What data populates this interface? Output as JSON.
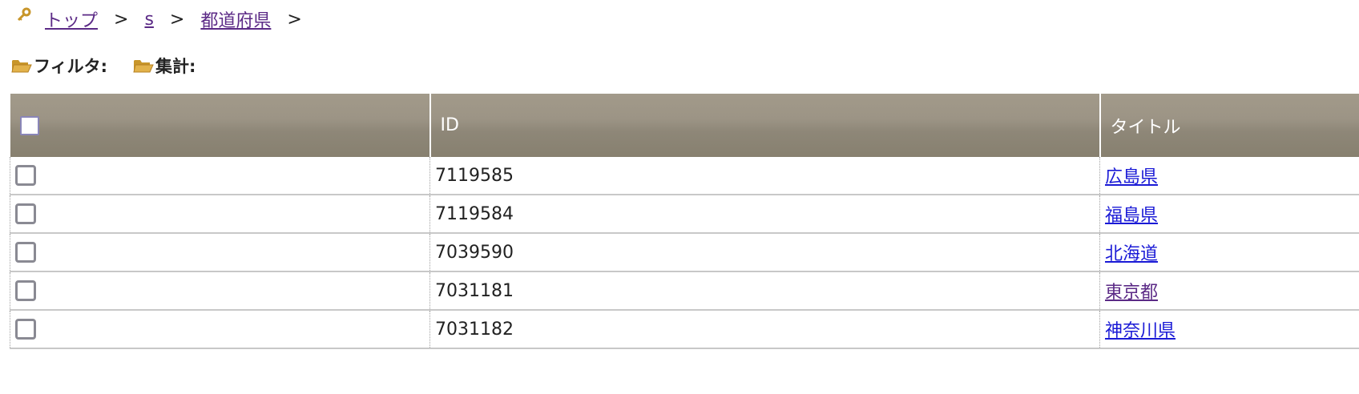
{
  "breadcrumb": {
    "icon": "link-icon",
    "items": [
      "トップ",
      "s",
      "都道府県"
    ],
    "separator": ">"
  },
  "toolbar": {
    "filter_label": "フィルタ:",
    "aggregate_label": "集計:",
    "icon": "folder-open-icon",
    "icon_color": "#d4a338"
  },
  "table": {
    "columns": [
      "",
      "ID",
      "タイトル"
    ],
    "header_gradient": [
      "#a29a8a",
      "#87806f"
    ],
    "rows": [
      {
        "id": "7119585",
        "title": "広島県"
      },
      {
        "id": "7119584",
        "title": "福島県"
      },
      {
        "id": "7039590",
        "title": "北海道"
      },
      {
        "id": "7031181",
        "title": "東京都"
      },
      {
        "id": "7031182",
        "title": "神奈川県"
      }
    ]
  }
}
